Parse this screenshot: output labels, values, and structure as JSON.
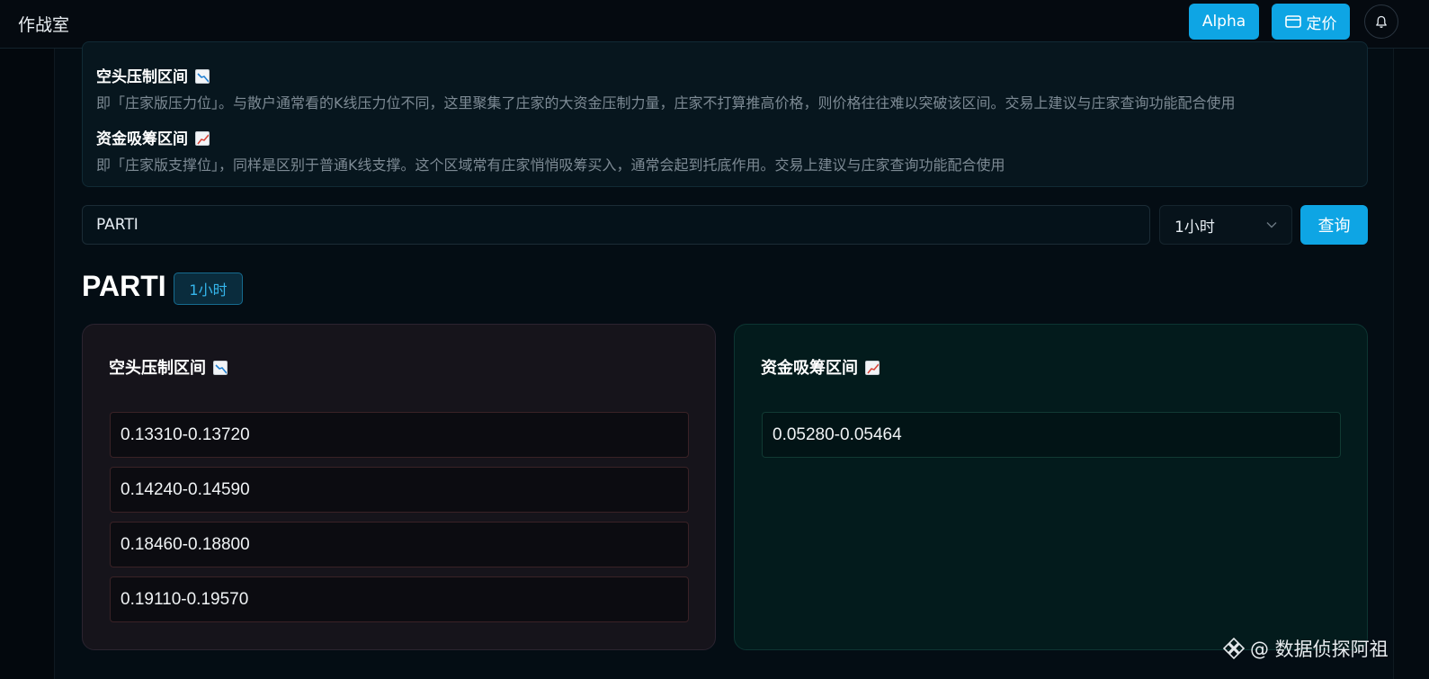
{
  "header": {
    "title": "作战室",
    "alpha_label": "Alpha",
    "pricing_label": "定价"
  },
  "info": {
    "short_title": "空头压制区间",
    "short_desc": "即「庄家版压力位」。与散户通常看的K线压力位不同，这里聚集了庄家的大资金压制力量，庄家不打算推高价格，则价格往往难以突破该区间。交易上建议与庄家查询功能配合使用",
    "accum_title": "资金吸筹区间",
    "accum_desc": "即「庄家版支撑位」，同样是区别于普通K线支撑。这个区域常有庄家悄悄吸筹买入，通常会起到托底作用。交易上建议与庄家查询功能配合使用"
  },
  "search": {
    "value": "PARTI",
    "timeframe": "1小时",
    "query_label": "查询"
  },
  "result": {
    "symbol": "PARTI",
    "timeframe": "1小时",
    "short_panel": {
      "title": "空头压制区间",
      "zones": [
        "0.13310-0.13720",
        "0.14240-0.14590",
        "0.18460-0.18800",
        "0.19110-0.19570"
      ]
    },
    "accum_panel": {
      "title": "资金吸筹区间",
      "zones": [
        "0.05280-0.05464"
      ]
    }
  },
  "watermark": "@ 数据侦探阿祖",
  "colors": {
    "accent": "#0ea5e4",
    "background": "#040d14"
  }
}
